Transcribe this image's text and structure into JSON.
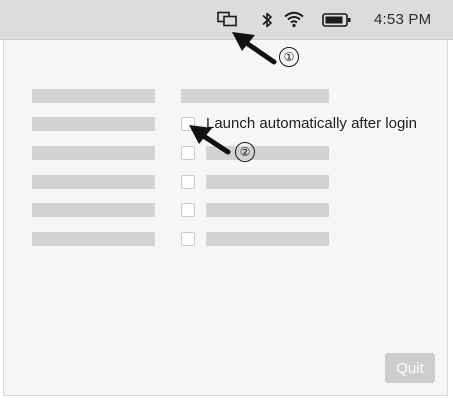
{
  "menubar": {
    "icons": [
      "display-mirror-icon",
      "bluetooth-icon",
      "wifi-icon",
      "battery-icon"
    ],
    "time": "4:53 PM",
    "background_color": "#dcdcdc"
  },
  "panel": {
    "checkbox_label": "Launch automatically after login",
    "checkbox_checked": false,
    "quit_label": "Quit",
    "quit_button_color": "#cdcdcd",
    "placeholder_color": "#d3d3d3"
  },
  "callouts": [
    {
      "number": "①",
      "target": "menubar app icon"
    },
    {
      "number": "②",
      "target": "launch automatically checkbox"
    }
  ]
}
